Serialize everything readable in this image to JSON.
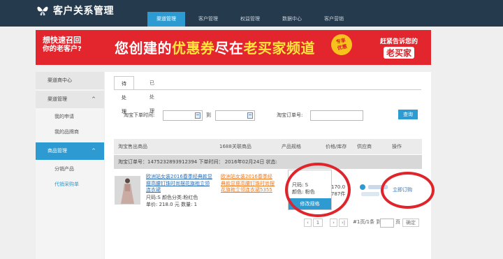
{
  "app": {
    "title": "客户关系管理",
    "logo_icon": "butterfly-logo-icon"
  },
  "nav": {
    "tabs": [
      {
        "label": "渠道管理",
        "active": true
      },
      {
        "label": "客户管理",
        "active": false
      },
      {
        "label": "权益管理",
        "active": false
      },
      {
        "label": "数据中心",
        "active": false
      },
      {
        "label": "客户营销",
        "active": false
      }
    ]
  },
  "banner": {
    "left_line1": "想快速召回",
    "left_line2": "你的老客户?",
    "main_part1": "您创建的",
    "main_highlight1": "优惠券",
    "main_part2": "尽在",
    "main_highlight2": "老买家频道",
    "badge_line1": "专享",
    "badge_line2": "优惠",
    "right_line1": "赶紧告诉您的",
    "right_line2": "老买家"
  },
  "sidebar": {
    "items": [
      {
        "label": "渠道商中心",
        "type": "head"
      },
      {
        "label": "渠道管理",
        "type": "head",
        "arrow": "^"
      },
      {
        "label": "我的申请",
        "type": "sub"
      },
      {
        "label": "我的品牌商",
        "type": "sub"
      },
      {
        "label": "商品管理",
        "type": "head",
        "arrow": "^",
        "active": true
      },
      {
        "label": "分销产品",
        "type": "sub"
      },
      {
        "label": "代销采购单",
        "type": "sub",
        "active": true
      }
    ]
  },
  "tabs": {
    "pending": "待处理",
    "done": "已处理"
  },
  "filter": {
    "order_time_label": "淘宝下单时间:",
    "to_label": "到",
    "order_no_label": "淘宝订单号:",
    "query_button": "查询"
  },
  "table": {
    "headers": [
      "淘宝售出商品",
      "1688关联商品",
      "产品规格",
      "价格/库存",
      "供应商",
      "操作"
    ],
    "order_bar": "淘宝订单号：1475232893912394 下单时间：  2016年02月24日  状态:",
    "row": {
      "product_title": "欧洲站女装2016春季经典新款 显瘦高腰钉珠时尚摆花旗袍立领连衣裙",
      "product_title_display": "欧洲站女装2016春季经典款显瘦高腰钉珠时尚摆花旗袍立领连衣裙",
      "size_color": "尺码:S 颜色分类:粉红色",
      "price_qty": "单价: 218.0 元 数量: 1",
      "related_title": "欧洲站女装2016春季经典款显瘦高腰钉珠时尚摆花旗袍立领连衣裙5355",
      "spec_size": "尺码: S",
      "spec_color": "颜色: 粉色",
      "spec_button": "修改规格",
      "price": "170.0",
      "stock": "787件",
      "action": "立即订购"
    }
  },
  "pager": {
    "prev": "‹",
    "page": "1",
    "next": "›",
    "last": "›|",
    "info": "#1页/1条 到",
    "page_suffix": "页",
    "go_button": "确定"
  },
  "colors": {
    "topbar": "#263a4d",
    "accent": "#2d9bd1",
    "banner_red": "#e3262e",
    "highlight_yellow": "#ffe43a",
    "annotation_red": "#e0242b"
  }
}
